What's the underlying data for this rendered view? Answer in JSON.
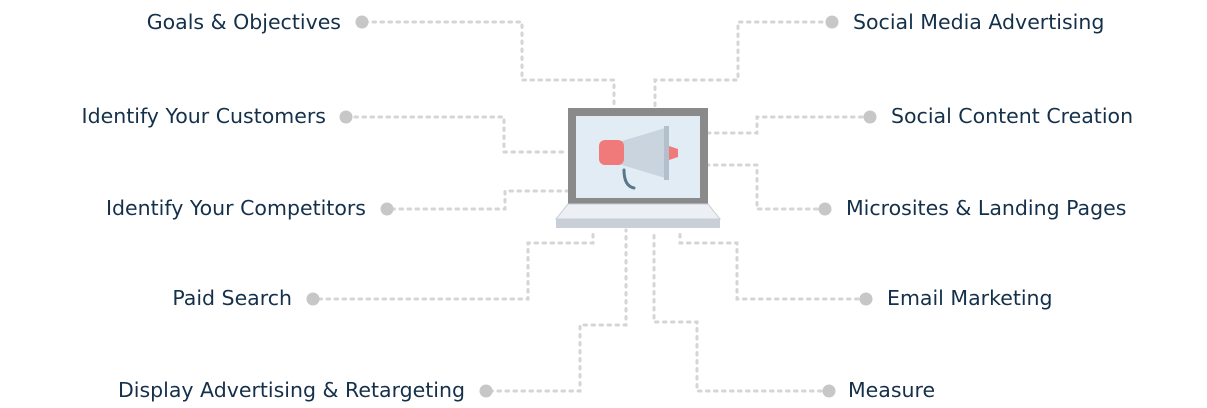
{
  "left_items": [
    {
      "label": "Goals & Objectives"
    },
    {
      "label": "Identify Your Customers"
    },
    {
      "label": "Identify Your Competitors"
    },
    {
      "label": "Paid Search"
    },
    {
      "label": "Display Advertising & Retargeting"
    }
  ],
  "right_items": [
    {
      "label": "Social Media Advertising"
    },
    {
      "label": "Social Content Creation"
    },
    {
      "label": "Microsites & Landing Pages"
    },
    {
      "label": "Email Marketing"
    },
    {
      "label": "Measure"
    }
  ],
  "center": {
    "icon": "laptop-megaphone-icon"
  },
  "colors": {
    "text": "#14304a",
    "connector": "#d5d5d5",
    "dot": "#c7c7c7",
    "megaphone_red": "#f07a7a",
    "megaphone_body": "#c9d4de",
    "screen": "#e2ecf5",
    "laptop_frame": "#8a8a8a"
  }
}
